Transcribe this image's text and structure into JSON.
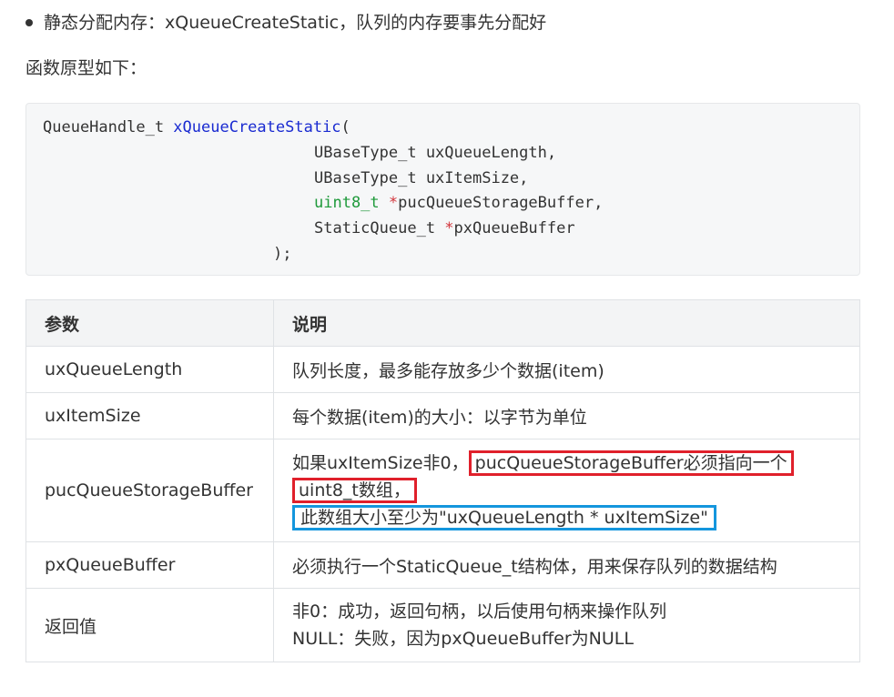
{
  "bullet": {
    "text": "静态分配内存：xQueueCreateStatic，队列的内存要事先分配好"
  },
  "intro": {
    "text": "函数原型如下："
  },
  "code": {
    "return_type": "QueueHandle_t ",
    "fn_name": "xQueueCreateStatic",
    "open": "(",
    "p1": "UBaseType_t uxQueueLength,",
    "p2": "UBaseType_t uxItemSize,",
    "p3_type": "uint8_t ",
    "p3_star": "*",
    "p3_name": "pucQueueStorageBuffer,",
    "p4_type": "StaticQueue_t ",
    "p4_star": "*",
    "p4_name": "pxQueueBuffer",
    "close": ");"
  },
  "table": {
    "header": {
      "col1": "参数",
      "col2": "说明"
    },
    "rows": [
      {
        "param": "uxQueueLength",
        "desc": "队列长度，最多能存放多少个数据(item)"
      },
      {
        "param": "uxItemSize",
        "desc": "每个数据(item)的大小：以字节为单位"
      },
      {
        "param": "pucQueueStorageBuffer",
        "desc_a": "如果uxItemSize非0，",
        "desc_b": "pucQueueStorageBuffer必须指向一个",
        "desc_c": "uint8_t数组，",
        "desc_d": "此数组大小至少为\"uxQueueLength * uxItemSize\""
      },
      {
        "param": "pxQueueBuffer",
        "desc": "必须执行一个StaticQueue_t结构体，用来保存队列的数据结构"
      },
      {
        "param": "返回值",
        "desc_1": "非0：成功，返回句柄，以后使用句柄来操作队列",
        "desc_2": "NULL：失败，因为pxQueueBuffer为NULL"
      }
    ]
  },
  "colors": {
    "highlight_red": "#e0202b",
    "highlight_blue": "#1496dd",
    "fn": "#1a2bd1",
    "type_kw": "#1f9a3b",
    "pointer": "#d2343b"
  }
}
